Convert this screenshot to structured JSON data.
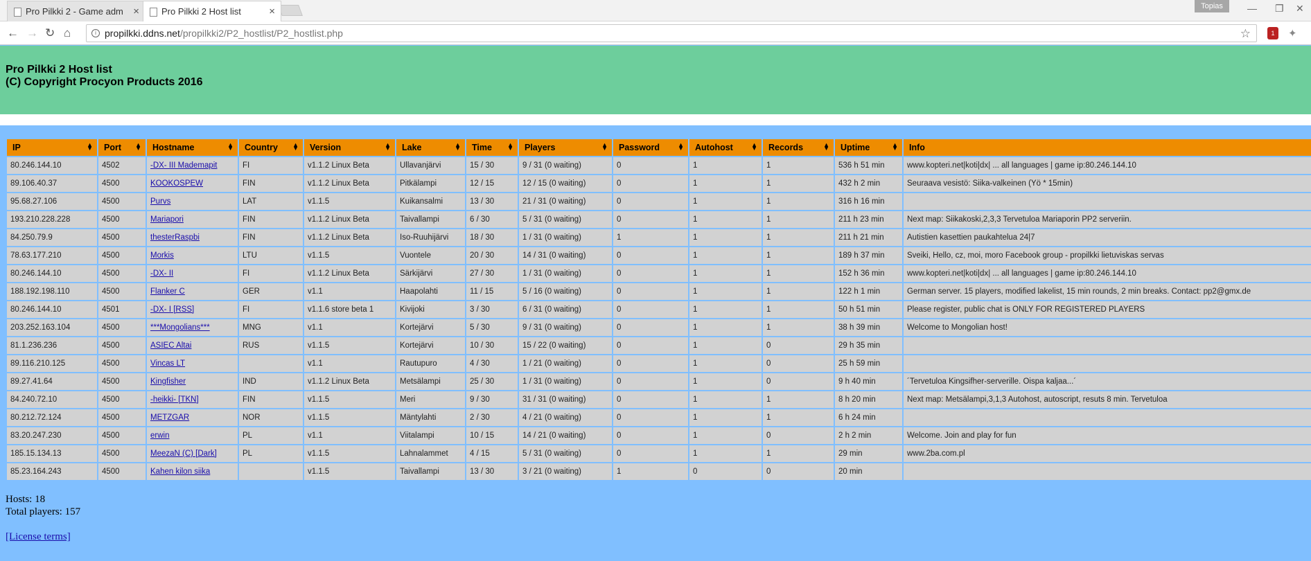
{
  "browser": {
    "tabs": [
      {
        "title": "Pro Pilkki 2 - Game adm"
      },
      {
        "title": "Pro Pilkki 2 Host list"
      }
    ],
    "profile_name": "Topias",
    "url_host": "propilkki.ddns.net",
    "url_path": "/propilkki2/P2_hostlist/P2_hostlist.php",
    "extension_badge": "1"
  },
  "banner": {
    "title": "Pro Pilkki 2 Host list",
    "copyright": "(C) Copyright Procyon Products 2016"
  },
  "table": {
    "headers": [
      "IP",
      "Port",
      "Hostname",
      "Country",
      "Version",
      "Lake",
      "Time",
      "Players",
      "Password",
      "Autohost",
      "Records",
      "Uptime",
      "Info"
    ],
    "rows": [
      [
        "80.246.144.10",
        "4502",
        "-DX- III Mademapit",
        "FI",
        "v1.1.2 Linux Beta",
        "Ullavanjärvi",
        "15 / 30",
        "9 / 31 (0 waiting)",
        "0",
        "1",
        "1",
        "536 h 51 min",
        "www.kopteri.net|koti|dx| ... all languages | game ip:80.246.144.10"
      ],
      [
        "89.106.40.37",
        "4500",
        "KOOKOSPEW",
        "FIN",
        "v1.1.2 Linux Beta",
        "Pitkälampi",
        "12 / 15",
        "12 / 15 (0 waiting)",
        "0",
        "1",
        "1",
        "432 h 2 min",
        "Seuraava vesistö: Siika-valkeinen (Yö * 15min)"
      ],
      [
        "95.68.27.106",
        "4500",
        "Purvs",
        "LAT",
        "v1.1.5",
        "Kuikansalmi",
        "13 / 30",
        "21 / 31 (0 waiting)",
        "0",
        "1",
        "1",
        "316 h 16 min",
        ""
      ],
      [
        "193.210.228.228",
        "4500",
        "Mariapori",
        "FIN",
        "v1.1.2 Linux Beta",
        "Taivallampi",
        "6 / 30",
        "5 / 31 (0 waiting)",
        "0",
        "1",
        "1",
        "211 h 23 min",
        "Next map: Siikakoski,2,3,3 Tervetuloa Mariaporin PP2 serveriin."
      ],
      [
        "84.250.79.9",
        "4500",
        "thesterRaspbi",
        "FIN",
        "v1.1.2 Linux Beta",
        "Iso-Ruuhijärvi",
        "18 / 30",
        "1 / 31 (0 waiting)",
        "1",
        "1",
        "1",
        "211 h 21 min",
        "Autistien kasettien paukahtelua 24|7"
      ],
      [
        "78.63.177.210",
        "4500",
        "Morkis",
        "LTU",
        "v1.1.5",
        "Vuontele",
        "20 / 30",
        "14 / 31 (0 waiting)",
        "0",
        "1",
        "1",
        "189 h 37 min",
        "Sveiki, Hello, cz, moi, moro Facebook group - propilkki lietuviskas servas"
      ],
      [
        "80.246.144.10",
        "4500",
        "-DX- II",
        "FI",
        "v1.1.2 Linux Beta",
        "Särkijärvi",
        "27 / 30",
        "1 / 31 (0 waiting)",
        "0",
        "1",
        "1",
        "152 h 36 min",
        "www.kopteri.net|koti|dx| ... all languages | game ip:80.246.144.10"
      ],
      [
        "188.192.198.110",
        "4500",
        "Flanker C",
        "GER",
        "v1.1",
        "Haapolahti",
        "11 / 15",
        "5 / 16 (0 waiting)",
        "0",
        "1",
        "1",
        "122 h 1 min",
        "German server. 15 players, modified lakelist, 15 min rounds, 2 min breaks. Contact: pp2@gmx.de"
      ],
      [
        "80.246.144.10",
        "4501",
        "-DX- I [RSS]",
        "FI",
        "v1.1.6 store beta 1",
        "Kivijoki",
        "3 / 30",
        "6 / 31 (0 waiting)",
        "0",
        "1",
        "1",
        "50 h 51 min",
        "Please register, public chat is ONLY FOR REGISTERED PLAYERS"
      ],
      [
        "203.252.163.104",
        "4500",
        "***Mongolians***",
        "MNG",
        "v1.1",
        "Kortejärvi",
        "5 / 30",
        "9 / 31 (0 waiting)",
        "0",
        "1",
        "1",
        "38 h 39 min",
        "Welcome to Mongolian host!"
      ],
      [
        "81.1.236.236",
        "4500",
        "ASIEC Altai",
        "RUS",
        "v1.1.5",
        "Kortejärvi",
        "10 / 30",
        "15 / 22 (0 waiting)",
        "0",
        "1",
        "0",
        "29 h 35 min",
        ""
      ],
      [
        "89.116.210.125",
        "4500",
        "Vincas LT",
        "",
        "v1.1",
        "Rautupuro",
        "4 / 30",
        "1 / 21 (0 waiting)",
        "0",
        "1",
        "0",
        "25 h 59 min",
        ""
      ],
      [
        "89.27.41.64",
        "4500",
        "Kingfisher",
        "IND",
        "v1.1.2 Linux Beta",
        "Metsälampi",
        "25 / 30",
        "1 / 31 (0 waiting)",
        "0",
        "1",
        "0",
        "9 h 40 min",
        "´Tervetuloa Kingsifher-serverille. Oispa kaljaa...´"
      ],
      [
        "84.240.72.10",
        "4500",
        "-heikki- [TKN]",
        "FIN",
        "v1.1.5",
        "Meri",
        "9 / 30",
        "31 / 31 (0 waiting)",
        "0",
        "1",
        "1",
        "8 h 20 min",
        "Next map: Metsälampi,3,1,3 Autohost, autoscript, resuts 8 min. Tervetuloa"
      ],
      [
        "80.212.72.124",
        "4500",
        "METZGAR",
        "NOR",
        "v1.1.5",
        "Mäntylahti",
        "2 / 30",
        "4 / 21 (0 waiting)",
        "0",
        "1",
        "1",
        "6 h 24 min",
        ""
      ],
      [
        "83.20.247.230",
        "4500",
        "erwin",
        "PL",
        "v1.1",
        "Viitalampi",
        "10 / 15",
        "14 / 21 (0 waiting)",
        "0",
        "1",
        "0",
        "2 h 2 min",
        "Welcome. Join and play for fun"
      ],
      [
        "185.15.134.13",
        "4500",
        "MeezaN (C) [Dark]",
        "PL",
        "v1.1.5",
        "Lahnalammet",
        "4 / 15",
        "5 / 31 (0 waiting)",
        "0",
        "1",
        "1",
        "29 min",
        "www.2ba.com.pl"
      ],
      [
        "85.23.164.243",
        "4500",
        "Kahen kilon siika",
        "",
        "v1.1.5",
        "Taivallampi",
        "13 / 30",
        "3 / 21 (0 waiting)",
        "1",
        "0",
        "0",
        "20 min",
        ""
      ]
    ]
  },
  "footer": {
    "hosts": "Hosts: 18",
    "total_players": "Total players: 157",
    "license_link": "[License terms]"
  }
}
